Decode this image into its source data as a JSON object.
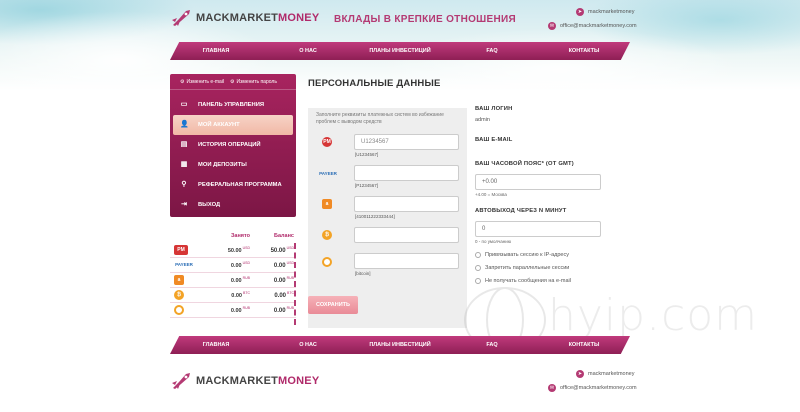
{
  "brand": {
    "name_part1": "MACKMARKET",
    "name_part2": "MONEY",
    "slogan": "ВКЛАДЫ В КРЕПКИЕ ОТНОШЕНИЯ"
  },
  "contacts": {
    "telegram": "mackmarketmoney",
    "email": "office@mackmarketmoney.com"
  },
  "nav": [
    "ГЛАВНАЯ",
    "О НАС",
    "ПЛАНЫ ИНВЕСТИЦИЙ",
    "FAQ",
    "КОНТАКТЫ"
  ],
  "nav_bottom": [
    "ГЛАВНАЯ",
    "О НАС",
    "ПЛАНЫ ИНВЕСТИЦИЙ",
    "FAQ",
    "КОНТАКТЫ"
  ],
  "sidebar": {
    "links": [
      "Изменить e-mail",
      "Изменить пароль"
    ],
    "menu": [
      {
        "label": "ПАНЕЛЬ УПРАВЛЕНИЯ",
        "icon": "folder-icon",
        "active": false
      },
      {
        "label": "МОЙ АККАУНТ",
        "icon": "user-icon",
        "active": true
      },
      {
        "label": "ИСТОРИЯ ОПЕРАЦИЙ",
        "icon": "history-icon",
        "active": false
      },
      {
        "label": "МОИ ДЕПОЗИТЫ",
        "icon": "deposits-icon",
        "active": false
      },
      {
        "label": "РЕФЕРАЛЬНАЯ ПРОГРАММА",
        "icon": "link-icon",
        "active": false
      },
      {
        "label": "ВЫХОД",
        "icon": "exit-icon",
        "active": false
      }
    ]
  },
  "balance": {
    "headers": [
      "Занято",
      "Баланс"
    ],
    "rows": [
      {
        "system": "PM",
        "color": "#d63535",
        "busy": "50.00",
        "busy_cur": "USD",
        "bal": "50.00",
        "bal_cur": "USD"
      },
      {
        "system": "PAYEER",
        "color": "#2a6db5",
        "busy": "0.00",
        "busy_cur": "USD",
        "bal": "0.00",
        "bal_cur": "USD"
      },
      {
        "system": "ADV",
        "color": "#f08a24",
        "busy": "0.00",
        "busy_cur": "RUB",
        "bal": "0.00",
        "bal_cur": "RUB"
      },
      {
        "system": "BTC",
        "color": "#f3a326",
        "busy": "0.00",
        "busy_cur": "BTC",
        "bal": "0.00",
        "bal_cur": "BTC"
      },
      {
        "system": "QIWI",
        "color": "#f3a326",
        "busy": "0.00",
        "busy_cur": "RUB",
        "bal": "0.00",
        "bal_cur": "RUB"
      }
    ]
  },
  "page": {
    "title": "ПЕРСОНАЛЬНЫЕ ДАННЫЕ"
  },
  "wallets": {
    "note": "Заполните реквизиты платежных систем во избежание проблем с выводом средств",
    "fields": [
      {
        "system": "PM",
        "value": "U1234567",
        "hint": "[U1234567]"
      },
      {
        "system": "PAYEER",
        "value": "",
        "hint": "[P1234567]"
      },
      {
        "system": "ADV",
        "value": "",
        "hint": "[410011222333444]"
      },
      {
        "system": "BTC",
        "value": "",
        "hint": ""
      },
      {
        "system": "QIWI",
        "value": "",
        "hint": "[bitcoin]"
      }
    ],
    "save": "СОХРАНИТЬ"
  },
  "account": {
    "login_label": "ВАШ ЛОГИН",
    "login_value": "admin",
    "email_label": "ВАШ E-MAIL",
    "tz_label": "ВАШ ЧАСОВОЙ ПОЯС* (ОТ GMT)",
    "tz_value": "+0.00",
    "tz_hint": "+4.00 = Москва",
    "autoexit_label": "АВТОВЫХОД ЧЕРЕЗ N МИНУТ",
    "autoexit_value": "0",
    "autoexit_hint": "0 - по умолчанию",
    "checks": [
      "Привязывать сессию к IP-адресу",
      "Запретить параллельные сессии",
      "Не получать сообщения на e-mail"
    ]
  },
  "watermark": "hyip.com"
}
